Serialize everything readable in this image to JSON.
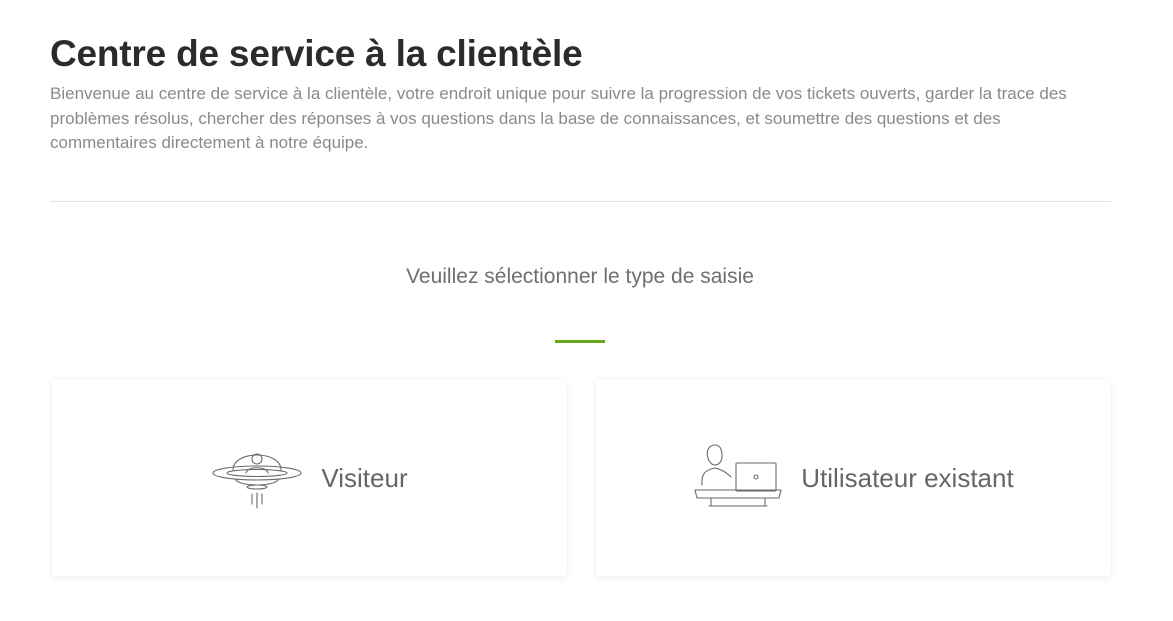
{
  "header": {
    "title": "Centre de service à la clientèle",
    "intro": "Bienvenue au centre de service à la clientèle, votre endroit unique pour suivre la progression de vos tickets ouverts, garder la trace des problèmes résolus, chercher des réponses à vos questions dans la base de connaissances, et soumettre des questions et des commentaires directement à notre équipe."
  },
  "selection": {
    "prompt": "Veuillez sélectionner le type de saisie",
    "accent_color": "#6aa51e",
    "options": [
      {
        "label": "Visiteur",
        "icon": "ufo-visitor-icon"
      },
      {
        "label": "Utilisateur existant",
        "icon": "user-at-laptop-icon"
      }
    ]
  }
}
